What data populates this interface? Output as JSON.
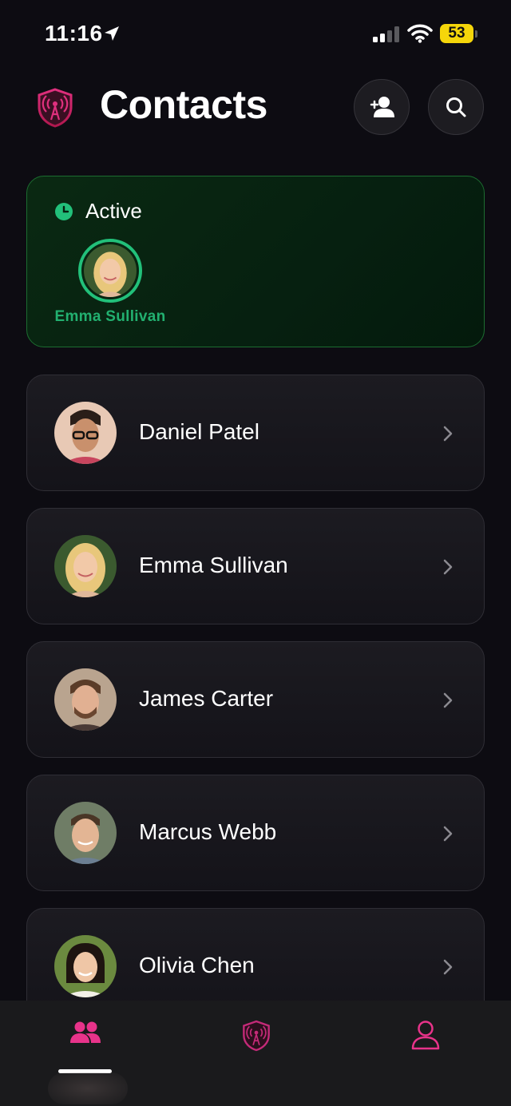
{
  "status_bar": {
    "time": "11:16",
    "battery": "53"
  },
  "header": {
    "title": "Contacts"
  },
  "active_section": {
    "label": "Active",
    "contacts": [
      {
        "name": "Emma Sullivan"
      }
    ]
  },
  "contacts": [
    {
      "name": "Daniel Patel"
    },
    {
      "name": "Emma Sullivan"
    },
    {
      "name": "James Carter"
    },
    {
      "name": "Marcus Webb"
    },
    {
      "name": "Olivia Chen"
    }
  ],
  "tab_bar": {
    "tabs": [
      {
        "icon": "people-icon",
        "selected": true
      },
      {
        "icon": "shield-signal-icon",
        "selected": false
      },
      {
        "icon": "person-icon",
        "selected": false
      }
    ]
  },
  "colors": {
    "accent": "#e8338a",
    "active_green": "#22c07a",
    "background": "#0d0c12"
  }
}
